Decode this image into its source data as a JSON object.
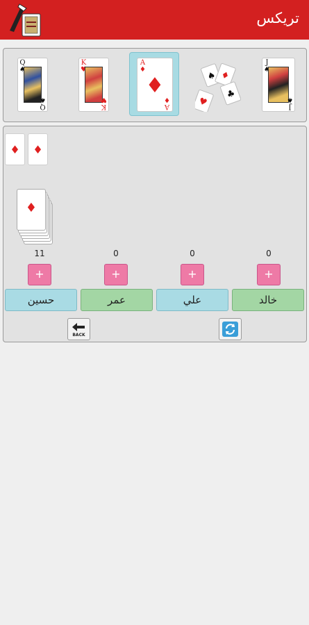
{
  "app": {
    "title": "تريكس",
    "logo_icon": "quill-card-logo-icon",
    "bar_color": "#d32020"
  },
  "modes": [
    {
      "name": "jack-of-diamonds",
      "rank": "J",
      "suit": "♠",
      "color": "black"
    },
    {
      "name": "queens",
      "rank": "",
      "suit": "♠♥",
      "color": "mixed"
    },
    {
      "name": "diamonds",
      "rank": "A",
      "suit": "♦",
      "color": "red",
      "selected": true
    },
    {
      "name": "king-of-hearts",
      "rank": "K",
      "suit": "♥",
      "color": "red"
    },
    {
      "name": "tricks",
      "rank": "Q",
      "suit": "♠",
      "color": "black"
    }
  ],
  "played_cards": [
    {
      "suit": "♦"
    },
    {
      "suit": "♦"
    }
  ],
  "deck": {
    "suit": "♦"
  },
  "players": [
    {
      "name": "حسين",
      "score": "11",
      "style": "blue"
    },
    {
      "name": "عمر",
      "score": "0",
      "style": "green"
    },
    {
      "name": "علي",
      "score": "0",
      "style": "blue"
    },
    {
      "name": "خالد",
      "score": "0",
      "style": "green"
    }
  ],
  "buttons": {
    "plus_label": "+",
    "back_label": "BACK",
    "back_icon": "back-arrow-icon",
    "refresh_icon": "refresh-icon"
  }
}
